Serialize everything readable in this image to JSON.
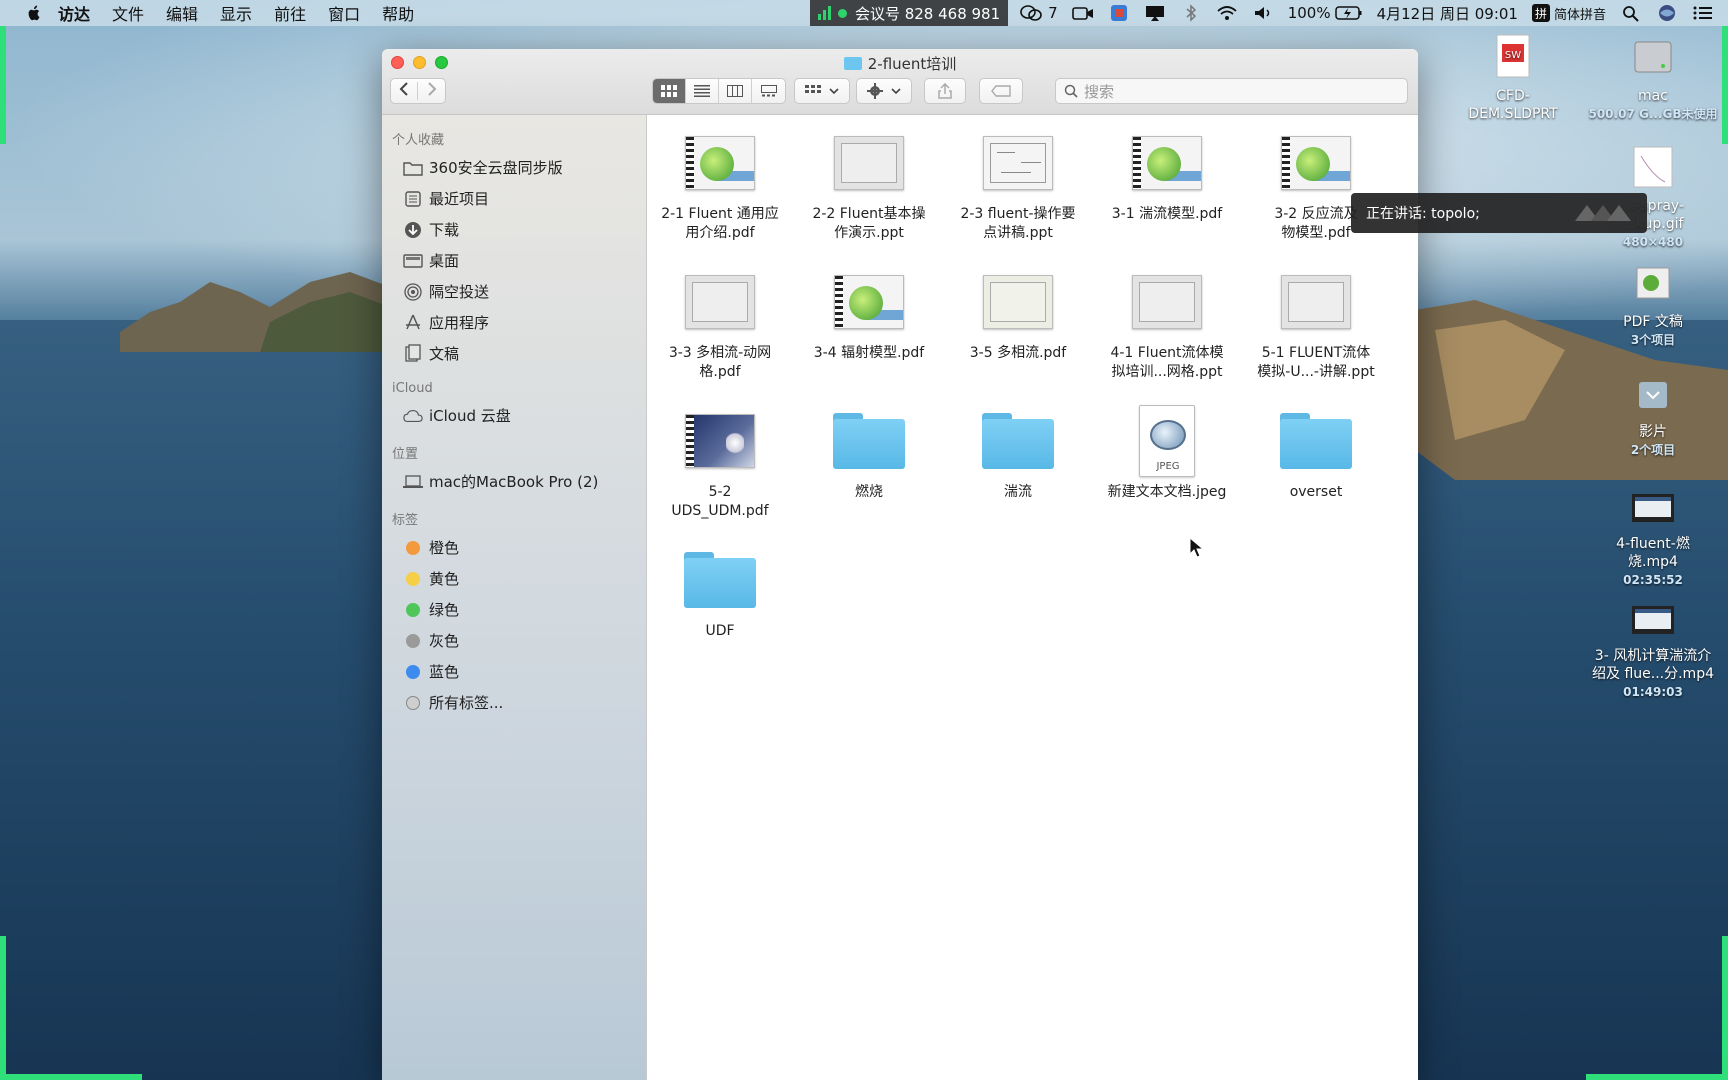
{
  "menubar": {
    "items": [
      "访达",
      "文件",
      "编辑",
      "显示",
      "前往",
      "窗口",
      "帮助"
    ],
    "meeting_text": "会议号 828 468 981",
    "wechat_count": "7",
    "battery": "100%",
    "datetime": "4月12日 周日 09:01",
    "input_method": "简体拼音"
  },
  "window": {
    "title": "2-fluent培训",
    "search_placeholder": "搜索"
  },
  "sidebar": {
    "favorites_header": "个人收藏",
    "favorites": [
      {
        "label": "360安全云盘同步版",
        "icon": "folder-icon"
      },
      {
        "label": "最近项目",
        "icon": "recents-icon"
      },
      {
        "label": "下载",
        "icon": "download-icon"
      },
      {
        "label": "桌面",
        "icon": "desktop-icon"
      },
      {
        "label": "隔空投送",
        "icon": "airdrop-icon"
      },
      {
        "label": "应用程序",
        "icon": "applications-icon"
      },
      {
        "label": "文稿",
        "icon": "documents-icon"
      }
    ],
    "icloud_header": "iCloud",
    "icloud": [
      {
        "label": "iCloud 云盘",
        "icon": "cloud-icon"
      }
    ],
    "locations_header": "位置",
    "locations": [
      {
        "label": "mac的MacBook Pro (2)",
        "icon": "laptop-icon"
      }
    ],
    "tags_header": "标签",
    "tags": [
      {
        "label": "橙色",
        "color": "#f39a3e"
      },
      {
        "label": "黄色",
        "color": "#f5cf48"
      },
      {
        "label": "绿色",
        "color": "#4fc65a"
      },
      {
        "label": "灰色",
        "color": "#9a9a9a"
      },
      {
        "label": "蓝色",
        "color": "#3d8bef"
      },
      {
        "label": "所有标签...",
        "color": "#cfcfcf"
      }
    ]
  },
  "files": [
    {
      "name": "2-1 Fluent 通用应用介绍.pdf",
      "line1": "2-1 Fluent 通用应",
      "line2": "用介绍.pdf",
      "kind": "green"
    },
    {
      "name": "2-2 Fluent基本操作演示.ppt",
      "line1": "2-2 Fluent基本操",
      "line2": "作演示.ppt",
      "kind": "gray"
    },
    {
      "name": "2-3 fluent-操作要点讲稿.ppt",
      "line1": "2-3 fluent-操作要",
      "line2": "点讲稿.ppt",
      "kind": "diag"
    },
    {
      "name": "3-1 湍流模型.pdf",
      "line1": "3-1 湍流模型.pdf",
      "line2": "",
      "kind": "green"
    },
    {
      "name": "3-2 反应流及物模型.pdf",
      "line1": "3-2 反应流及",
      "line2": "物模型.pdf",
      "kind": "green"
    },
    {
      "name": "3-3 多相流-动网格.pdf",
      "line1": "3-3 多相流-动网",
      "line2": "格.pdf",
      "kind": "gray"
    },
    {
      "name": "3-4 辐射模型.pdf",
      "line1": "3-4 辐射模型.pdf",
      "line2": "",
      "kind": "green"
    },
    {
      "name": "3-5 多相流.pdf",
      "line1": "3-5 多相流.pdf",
      "line2": "",
      "kind": "gray"
    },
    {
      "name": "4-1 Fluent流体模拟培训...网格.ppt",
      "line1": "4-1 Fluent流体模",
      "line2": "拟培训...网格.ppt",
      "kind": "gray"
    },
    {
      "name": "5-1 FLUENT流体模拟-U...-讲解.ppt",
      "line1": "5-1 FLUENT流体",
      "line2": "模拟-U...-讲解.ppt",
      "kind": "gray"
    },
    {
      "name": "5-2 UDS_UDM.pdf",
      "line1": "5-2",
      "line2": "UDS_UDM.pdf",
      "kind": "dark"
    },
    {
      "name": "燃烧",
      "line1": "燃烧",
      "line2": "",
      "kind": "folder"
    },
    {
      "name": "湍流",
      "line1": "湍流",
      "line2": "",
      "kind": "folder"
    },
    {
      "name": "新建文本文档.jpeg",
      "line1": "新建文本文档.jpeg",
      "line2": "",
      "kind": "jpeg"
    },
    {
      "name": "overset",
      "line1": "overset",
      "line2": "",
      "kind": "folder"
    },
    {
      "name": "UDF",
      "line1": "UDF",
      "line2": "",
      "kind": "folder"
    }
  ],
  "jpeg_label": "JPEG",
  "tooltip": {
    "text": "正在讲话: topolo;"
  },
  "desktop": [
    {
      "line1": "CFD-",
      "line2": "DEM.SLDPRT",
      "sub": ""
    },
    {
      "line1": "mac",
      "line2": "",
      "sub": "500.07 G...GB未使用"
    },
    {
      "line1": "...-spray-",
      "line2": "...kup.gif",
      "sub": "480×480"
    },
    {
      "line1": "PDF 文稿",
      "line2": "",
      "sub": "3个项目"
    },
    {
      "line1": "影片",
      "line2": "",
      "sub": "2个项目"
    },
    {
      "line1": "4-fluent-燃",
      "line2": "烧.mp4",
      "sub": "02:35:52"
    },
    {
      "line1": "3- 风机计算湍流介",
      "line2": "绍及 flue...分.mp4",
      "sub": "01:49:03"
    }
  ]
}
